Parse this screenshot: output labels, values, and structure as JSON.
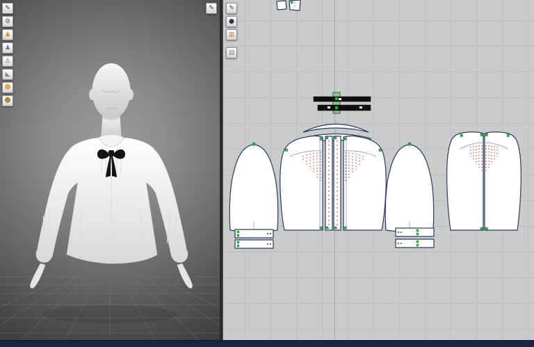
{
  "toolbars": {
    "avatar_toolbar": {
      "icons": [
        {
          "name": "pen-tool-icon",
          "glyph": "✎",
          "color": "#3b3b3b"
        },
        {
          "name": "gear-icon",
          "glyph": "⚙",
          "color": "#47566e"
        },
        {
          "name": "avatar-orange-icon",
          "glyph": "♟",
          "color": "#d9822b"
        },
        {
          "name": "avatar-blue-icon",
          "glyph": "♟",
          "color": "#5b7ba3"
        },
        {
          "name": "mannequin-icon",
          "glyph": "♙",
          "color": "#7d7d7d"
        },
        {
          "name": "shoe-icon",
          "glyph": "◣",
          "color": "#9b8468"
        },
        {
          "name": "head-icon",
          "glyph": "☻",
          "color": "#dd9f4b"
        },
        {
          "name": "hair-icon",
          "glyph": "☻",
          "color": "#b06f22"
        }
      ]
    },
    "pattern_toolbar": {
      "icons": [
        {
          "name": "pen-tool-icon",
          "glyph": "✎",
          "color": "#3b3b3b"
        },
        {
          "name": "sphere-icon",
          "glyph": "●",
          "color": "#253450"
        },
        {
          "name": "fabric-icon",
          "glyph": "▥",
          "color": "#cd7e2a"
        },
        {
          "name": "layers-icon",
          "glyph": "▤",
          "color": "#80878d"
        }
      ]
    },
    "corner_tool": {
      "name": "pen-tool-icon",
      "glyph": "✎",
      "color": "#3b3b3b"
    }
  },
  "viewport_3d": {
    "content": "3D avatar wearing white blouse with black neck bow"
  },
  "viewport_2d": {
    "content": "2D pattern pieces of the blouse"
  },
  "pattern_pieces": [
    "ribbon-center",
    "ribbon-bar-top",
    "ribbon-bar-bottom",
    "collar",
    "collar-stand",
    "left-sleeve",
    "front-left-bodice",
    "placket-left",
    "placket-right",
    "front-right-bodice",
    "right-sleeve",
    "back-left-bodice",
    "back-right-bodice",
    "cuff-left-top",
    "cuff-left-bottom",
    "cuff-right-top",
    "cuff-right-bottom",
    "partial-piece-a",
    "partial-piece-b"
  ],
  "colors": {
    "outline": "#2c3a5e",
    "inner_line": "#8492b0",
    "stitch_red": "#c22f2f",
    "notch_green": "#33b04a",
    "bow_black": "#0f0f0f",
    "panel_bg": "#c9cbcc",
    "grid": "#bdbfc0",
    "axis": "#a7a9ab",
    "divider": "#2b2b2b",
    "status_bar": "#1a2446"
  },
  "status_bar": {
    "text": ""
  }
}
